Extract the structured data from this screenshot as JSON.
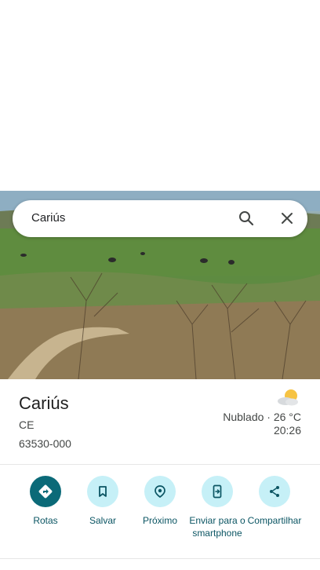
{
  "search": {
    "query": "Cariús"
  },
  "place": {
    "title": "Cariús",
    "region": "CE",
    "postal_code": "63530-000"
  },
  "weather": {
    "condition_temp": "Nublado · 26 °C",
    "time": "20:26",
    "icon": "partly-cloudy-icon"
  },
  "actions": [
    {
      "label": "Rotas",
      "icon": "directions-icon"
    },
    {
      "label": "Salvar",
      "icon": "bookmark-icon"
    },
    {
      "label": "Próximo",
      "icon": "nearby-icon"
    },
    {
      "label": "Enviar para o smartphone",
      "icon": "send-to-phone-icon"
    },
    {
      "label": "Compartilhar",
      "icon": "share-icon"
    }
  ],
  "colors": {
    "accent": "#0b6a78",
    "action_bg": "#c6f0f7",
    "action_text": "#0b5563"
  }
}
